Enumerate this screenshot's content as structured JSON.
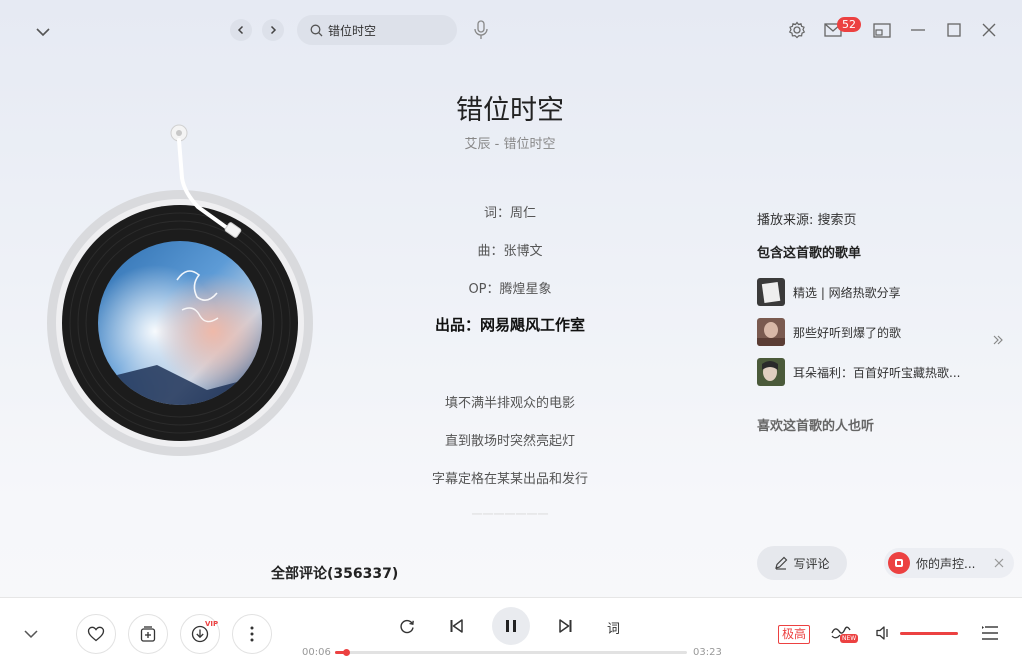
{
  "topbar": {
    "search_value": "错位时空",
    "notification_count": "52"
  },
  "song": {
    "title": "错位时空",
    "subtitle": "艾辰 - 错位时空"
  },
  "credits": [
    "词：周仁",
    "曲：张博文",
    "OP：腾煌星象"
  ],
  "publisher": "出品：网易飓风工作室",
  "lyrics": [
    "填不满半排观众的电影",
    "直到散场时突然亮起灯",
    "字幕定格在某某出品和发行"
  ],
  "faded_lyric": "一一一一一一一",
  "right_panel": {
    "source": "播放来源: 搜索页",
    "playlists_title": "包含这首歌的歌单",
    "playlists": [
      {
        "name": "精选 | 网络热歌分享",
        "thumb": "sheet-thumb"
      },
      {
        "name": "那些好听到爆了的歌",
        "thumb": "portrait-thumb"
      },
      {
        "name": "耳朵福利：百首好听宝藏热歌...",
        "thumb": "girl-thumb"
      }
    ],
    "also_listened_title": "喜欢这首歌的人也听"
  },
  "comments_label": "全部评论(356337)",
  "write_comment_label": "写评论",
  "promo_label": "你的声控...",
  "player": {
    "current_time": "00:06",
    "total_time": "03:23",
    "progress": 0.03,
    "vip_label": "VIP",
    "lyric_btn_label": "词",
    "quality_label": "极高",
    "new_label": "NEW",
    "volume": 1.0
  },
  "colors": {
    "accent": "#ec4141",
    "background": "#eef1f7"
  }
}
